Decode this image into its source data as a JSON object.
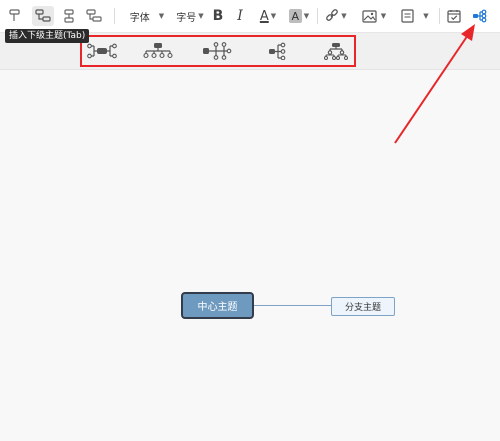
{
  "toolbar": {
    "font_label": "字体",
    "size_label": "字号",
    "bold_label": "B",
    "italic_label": "I",
    "font_color_label": "A",
    "highlight_label": "A",
    "tooltip": "插入下级主题(Tab)"
  },
  "layouts": [
    {
      "icon": "mind-map-layout-icon"
    },
    {
      "icon": "org-chart-layout-icon"
    },
    {
      "icon": "tree-layout-icon"
    },
    {
      "icon": "logic-right-layout-icon"
    },
    {
      "icon": "org-chart-down-layout-icon"
    }
  ],
  "canvas": {
    "center_topic": "中心主题",
    "branch_topic": "分支主题"
  },
  "colors": {
    "accent": "#1e78d7",
    "highlight_border": "#e8262a",
    "center_fill": "#6e9ac0",
    "center_border": "#333c4a",
    "branch_fill": "#eef4fb"
  }
}
